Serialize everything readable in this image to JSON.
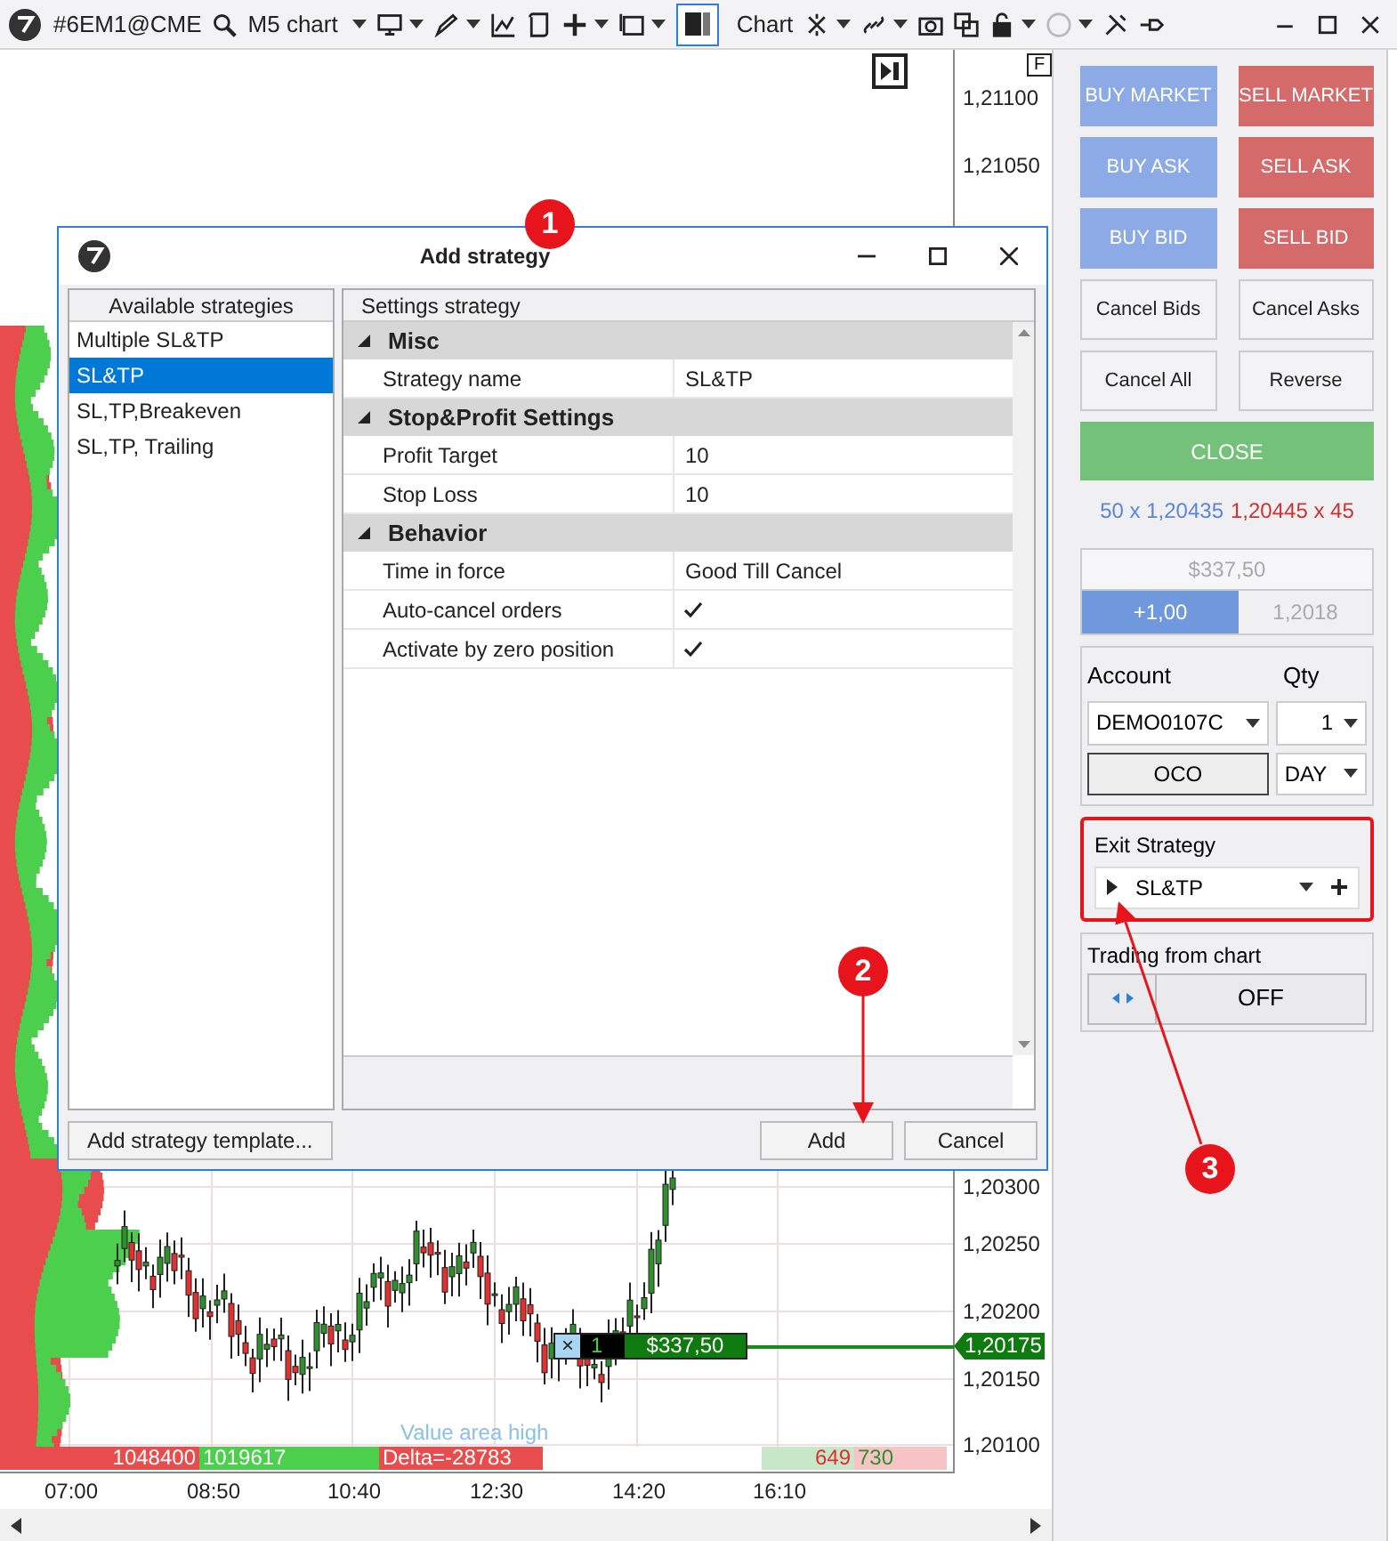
{
  "toolbar": {
    "symbol": "#6EM1@CME",
    "timeframe": "M5 chart",
    "chart_label": "Chart",
    "layout_toggle": {
      "selected": true
    }
  },
  "chart": {
    "f_button": "F",
    "price_labels": [
      "1,21100",
      "1,21050",
      "1,20300",
      "1,20250",
      "1,20200",
      "1,20150",
      "1,20100"
    ],
    "current_price": "1,20175",
    "time_labels": [
      "07:00",
      "08:50",
      "10:40",
      "12:30",
      "14:20",
      "16:10"
    ],
    "order_tag": {
      "close": "×",
      "quantity": "1",
      "pnl": "$337,50"
    },
    "value_area_label": "Value area high",
    "volume_bars": [
      {
        "text": "1048400",
        "color": "#e84c4c"
      },
      {
        "text": "1019617",
        "color": "#4ccf4c"
      },
      {
        "text": "Delta=-28783",
        "color": "#e84c4c"
      }
    ],
    "bid_ask": [
      {
        "text": "649",
        "color": "#c8e6c8"
      },
      {
        "text": "730",
        "color": "#f6c4c4"
      }
    ]
  },
  "dialog": {
    "title": "Add strategy",
    "left_header": "Available strategies",
    "strategies": [
      {
        "name": "Multiple SL&TP",
        "selected": false
      },
      {
        "name": "SL&TP",
        "selected": true
      },
      {
        "name": "SL,TP,Breakeven",
        "selected": false
      },
      {
        "name": "SL,TP, Trailing",
        "selected": false
      }
    ],
    "right_header": "Settings strategy",
    "groups": [
      {
        "name": "Misc",
        "expanded": true,
        "rows": [
          {
            "label": "Strategy name",
            "kind": "text",
            "value": "SL&TP"
          }
        ]
      },
      {
        "name": "Stop&Profit Settings",
        "expanded": true,
        "rows": [
          {
            "label": "Profit Target",
            "kind": "text",
            "value": "10"
          },
          {
            "label": "Stop Loss",
            "kind": "text",
            "value": "10"
          }
        ]
      },
      {
        "name": "Behavior",
        "expanded": true,
        "rows": [
          {
            "label": "Time in force",
            "kind": "text",
            "value": "Good Till Cancel"
          },
          {
            "label": "Auto-cancel orders",
            "kind": "checkbox",
            "checked": true
          },
          {
            "label": "Activate by zero position",
            "kind": "checkbox",
            "checked": true
          }
        ]
      }
    ],
    "template_button": "Add strategy template...",
    "add_button": "Add",
    "cancel_button": "Cancel"
  },
  "annotations": [
    {
      "number": "1"
    },
    {
      "number": "2"
    },
    {
      "number": "3"
    }
  ],
  "panel": {
    "order_buttons": [
      {
        "label": "BUY MARKET",
        "kind": "buy"
      },
      {
        "label": "SELL MARKET",
        "kind": "sell"
      },
      {
        "label": "BUY ASK",
        "kind": "buy"
      },
      {
        "label": "SELL ASK",
        "kind": "sell"
      },
      {
        "label": "BUY BID",
        "kind": "buy"
      },
      {
        "label": "SELL BID",
        "kind": "sell"
      },
      {
        "label": "Cancel Bids",
        "kind": "neutral"
      },
      {
        "label": "Cancel Asks",
        "kind": "neutral"
      },
      {
        "label": "Cancel All",
        "kind": "neutral"
      },
      {
        "label": "Reverse",
        "kind": "neutral"
      }
    ],
    "close_button": "CLOSE",
    "bid_quote": "50 x 1,20435",
    "ask_quote": "1,20445 x 45",
    "position": {
      "pnl": "$337,50",
      "qty": "+1,00",
      "price": "1,2018"
    },
    "account_label": "Account",
    "qty_label": "Qty",
    "account": "DEMO0107C",
    "qty": "1",
    "oco": "OCO",
    "time_in_force": "DAY",
    "exit_strategy": {
      "label": "Exit Strategy",
      "value": "SL&TP",
      "highlighted": true
    },
    "trading_from_chart": {
      "label": "Trading from chart",
      "state": "OFF"
    }
  }
}
